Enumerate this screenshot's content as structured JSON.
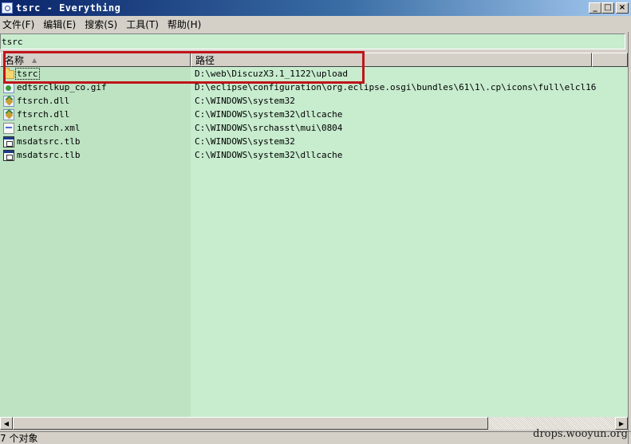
{
  "window": {
    "title": "tsrc - Everything",
    "icon": "everything-app-icon",
    "controls": {
      "minimize": "_",
      "maximize": "□",
      "close": "×"
    }
  },
  "menu": {
    "items": [
      {
        "label": "文件(F)"
      },
      {
        "label": "编辑(E)"
      },
      {
        "label": "搜索(S)"
      },
      {
        "label": "工具(T)"
      },
      {
        "label": "帮助(H)"
      }
    ]
  },
  "search": {
    "value": "tsrc"
  },
  "list": {
    "columns": [
      {
        "label": "名称",
        "sorted": "ascending",
        "sort_icon": "▲"
      },
      {
        "label": "路径"
      },
      {
        "label": ""
      }
    ],
    "rows": [
      {
        "name": "tsrc",
        "icon": "folder",
        "path": "D:\\web\\DiscuzX3.1_1122\\upload",
        "focused": true
      },
      {
        "name": "edtsrclkup_co.gif",
        "icon": "img",
        "path": "D:\\eclipse\\configuration\\org.eclipse.osgi\\bundles\\61\\1\\.cp\\icons\\full\\elcl16"
      },
      {
        "name": "ftsrch.dll",
        "icon": "dll",
        "path": "C:\\WINDOWS\\system32"
      },
      {
        "name": "ftsrch.dll",
        "icon": "dll",
        "path": "C:\\WINDOWS\\system32\\dllcache"
      },
      {
        "name": "inetsrch.xml",
        "icon": "xml",
        "path": "C:\\WINDOWS\\srchasst\\mui\\0804"
      },
      {
        "name": "msdatsrc.tlb",
        "icon": "tlb",
        "path": "C:\\WINDOWS\\system32"
      },
      {
        "name": "msdatsrc.tlb",
        "icon": "tlb",
        "path": "C:\\WINDOWS\\system32\\dllcache"
      }
    ]
  },
  "scrollbar": {
    "left_arrow": "◀",
    "right_arrow": "▶"
  },
  "status": {
    "text": "7 个对象"
  },
  "watermark": {
    "text": "drops.wooyun.org"
  },
  "colors": {
    "list_bg": "#c7ecce",
    "name_col_bg": "#bde3c2",
    "highlight": "#c0141a",
    "titlebar_start": "#0a246a",
    "titlebar_end": "#a6caf0"
  }
}
